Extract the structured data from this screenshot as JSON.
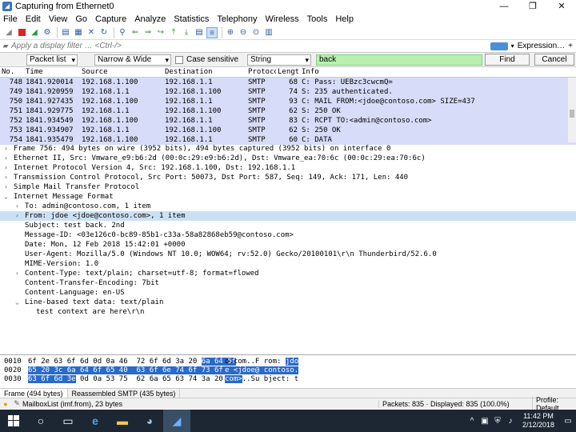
{
  "window": {
    "title": "Capturing from Ethernet0",
    "minimize": "—",
    "maximize": "❐",
    "close": "✕"
  },
  "menu": [
    "File",
    "Edit",
    "View",
    "Go",
    "Capture",
    "Analyze",
    "Statistics",
    "Telephony",
    "Wireless",
    "Tools",
    "Help"
  ],
  "filter": {
    "placeholder": "Apply a display filter … <Ctrl-/>",
    "expression_label": "Expression…"
  },
  "find": {
    "scope": "Packet list",
    "width": "Narrow & Wide",
    "case_label": "Case sensitive",
    "type": "String",
    "text": "back",
    "find_label": "Find",
    "cancel_label": "Cancel"
  },
  "packet_list": {
    "columns": [
      "No.",
      "Time",
      "Source",
      "Destination",
      "Protocol",
      "Length",
      "Info"
    ],
    "rows": [
      [
        "748",
        "1841.920014",
        "192.168.1.100",
        "192.168.1.1",
        "SMTP",
        "68",
        "C: Pass: UEBzc3cwcmQ="
      ],
      [
        "749",
        "1841.920959",
        "192.168.1.1",
        "192.168.1.100",
        "SMTP",
        "74",
        "S: 235 authenticated."
      ],
      [
        "750",
        "1841.927435",
        "192.168.1.100",
        "192.168.1.1",
        "SMTP",
        "93",
        "C: MAIL FROM:<jdoe@contoso.com> SIZE=437"
      ],
      [
        "751",
        "1841.929775",
        "192.168.1.1",
        "192.168.1.100",
        "SMTP",
        "62",
        "S: 250 OK"
      ],
      [
        "752",
        "1841.934549",
        "192.168.1.100",
        "192.168.1.1",
        "SMTP",
        "83",
        "C: RCPT TO:<admin@contoso.com>"
      ],
      [
        "753",
        "1841.934907",
        "192.168.1.1",
        "192.168.1.100",
        "SMTP",
        "62",
        "S: 250 OK"
      ],
      [
        "754",
        "1841.935479",
        "192.168.1.100",
        "192.168.1.1",
        "SMTP",
        "60",
        "C: DATA"
      ]
    ]
  },
  "details": [
    {
      "text": "Frame 756: 494 bytes on wire (3952 bits), 494 bytes captured (3952 bits) on interface 0",
      "indent": 0,
      "arrow": ">"
    },
    {
      "text": "Ethernet II, Src: Vmware_e9:b6:2d (00:0c:29:e9:b6:2d), Dst: Vmware_ea:70:6c (00:0c:29:ea:70:6c)",
      "indent": 0,
      "arrow": ">"
    },
    {
      "text": "Internet Protocol Version 4, Src: 192.168.1.100, Dst: 192.168.1.1",
      "indent": 0,
      "arrow": ">"
    },
    {
      "text": "Transmission Control Protocol, Src Port: 50073, Dst Port: 587, Seq: 149, Ack: 171, Len: 440",
      "indent": 0,
      "arrow": ">"
    },
    {
      "text": "Simple Mail Transfer Protocol",
      "indent": 0,
      "arrow": ">"
    },
    {
      "text": "Internet Message Format",
      "indent": 0,
      "arrow": "v"
    },
    {
      "text": "To: admin@contoso.com, 1 item",
      "indent": 1,
      "arrow": ">"
    },
    {
      "text": "From: jdoe <jdoe@contoso.com>, 1 item",
      "indent": 1,
      "arrow": ">",
      "highlight": true
    },
    {
      "text": "Subject: test back. 2nd",
      "indent": 1,
      "arrow": ""
    },
    {
      "text": "Message-ID: <03e126c0-bc89-85b1-c33a-58a82868eb59@contoso.com>",
      "indent": 1,
      "arrow": ""
    },
    {
      "text": "Date: Mon, 12 Feb 2018 15:42:01 +0000",
      "indent": 1,
      "arrow": ""
    },
    {
      "text": "User-Agent: Mozilla/5.0 (Windows NT 10.0; WOW64; rv:52.0) Gecko/20100101\\r\\n Thunderbird/52.6.0",
      "indent": 1,
      "arrow": ""
    },
    {
      "text": "MIME-Version: 1.0",
      "indent": 1,
      "arrow": ""
    },
    {
      "text": "Content-Type: text/plain; charset=utf-8; format=flowed",
      "indent": 1,
      "arrow": ">"
    },
    {
      "text": "Content-Transfer-Encoding: 7bit",
      "indent": 1,
      "arrow": ""
    },
    {
      "text": "Content-Language: en-US",
      "indent": 1,
      "arrow": ""
    },
    {
      "text": "Line-based text data: text/plain",
      "indent": 1,
      "arrow": "v"
    },
    {
      "text": "test context are here\\r\\n",
      "indent": 2,
      "arrow": ""
    }
  ],
  "bytes": [
    {
      "off": "0010",
      "hex_a": "6f 2e 63 6f 6d 0d 0a 46  72 6f 6d 3a 20 ",
      "hex_b": "6a 64 6f",
      "asc_a": "o.com..F rom: ",
      "asc_b": "jdo"
    },
    {
      "off": "0020",
      "hex_a": "",
      "hex_b": "65 20 3c 6a 64 6f 65 40  63 6f 6e 74 6f 73 6f 2e",
      "asc_a": "",
      "asc_b": "e <jdoe@ contoso."
    },
    {
      "off": "0030",
      "hex_a": "",
      "hex_b": "63 6f 6d 3e",
      "hex_c": " 0d 0a 53 75  62 6a 65 63 74 3a 20 74",
      "asc_a": "",
      "asc_b": "com>",
      "asc_c": "..Su bject: t"
    }
  ],
  "bytes_tabs": [
    "Frame (494 bytes)",
    "Reassembled SMTP (435 bytes)"
  ],
  "status": {
    "field": "MailboxList (imf.from), 23 bytes",
    "packets": "Packets: 835 · Displayed: 835 (100.0%)",
    "profile": "Profile: Default"
  },
  "taskbar": {
    "time": "11:42 PM",
    "date": "2/12/2018"
  }
}
